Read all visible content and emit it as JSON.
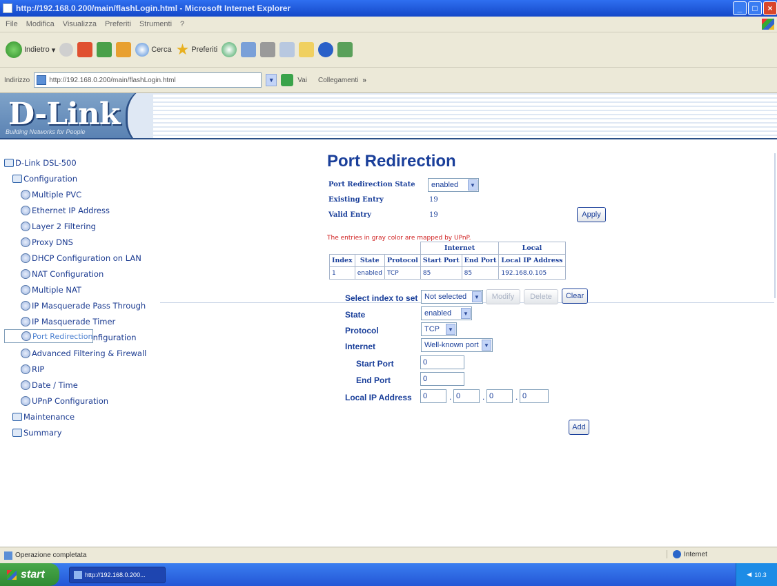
{
  "window": {
    "title": "http://192.168.0.200/main/flashLogin.html - Microsoft Internet Explorer"
  },
  "menu": [
    "File",
    "Modifica",
    "Visualizza",
    "Preferiti",
    "Strumenti",
    "?"
  ],
  "toolbar": {
    "back_label": "Indietro",
    "search_label": "Cerca",
    "favorites_label": "Preferiti"
  },
  "address": {
    "label": "Indirizzo",
    "url": "http://192.168.0.200/main/flashLogin.html",
    "go_label": "Vai",
    "links_label": "Collegamenti"
  },
  "banner": {
    "logo": "D-Link",
    "tagline": "Building Networks for People"
  },
  "tree": {
    "root": "D-Link DSL-500",
    "config": "Configuration",
    "items": [
      "Multiple PVC",
      "Ethernet IP Address",
      "Layer 2 Filtering",
      "Proxy DNS",
      "DHCP Configuration on LAN",
      "NAT Configuration",
      "Multiple NAT",
      "IP Masquerade Pass Through",
      "IP Masquerade Timer",
      "Port Redirection",
      "Static Route Configuration",
      "Advanced Filtering & Firewall",
      "RIP",
      "Date / Time",
      "UPnP Configuration"
    ],
    "maintenance": "Maintenance",
    "summary": "Summary"
  },
  "page": {
    "title": "Port Redirection",
    "state_label": "Port Redirection State",
    "state_value": "enabled",
    "existing_label": "Existing Entry",
    "existing_value": "19",
    "valid_label": "Valid Entry",
    "valid_value": "19",
    "apply_label": "Apply",
    "note": "The entries in gray color are mapped by UPnP.",
    "table": {
      "group_internet": "Internet",
      "group_local": "Local",
      "headers": [
        "Index",
        "State",
        "Protocol",
        "Start Port",
        "End Port",
        "Local IP Address"
      ],
      "rows": [
        [
          "1",
          "enabled",
          "TCP",
          "85",
          "85",
          "192.168.0.105"
        ]
      ]
    },
    "form": {
      "select_index_label": "Select index to set",
      "select_index_value": "Not selected",
      "modify_label": "Modify",
      "delete_label": "Delete",
      "clear_label": "Clear",
      "state_label": "State",
      "state_value": "enabled",
      "protocol_label": "Protocol",
      "protocol_value": "TCP",
      "internet_label": "Internet",
      "internet_value": "Well-known port",
      "start_port_label": "Start Port",
      "start_port_value": "0",
      "end_port_label": "End Port",
      "end_port_value": "0",
      "local_ip_label": "Local IP Address",
      "ip": [
        "0",
        "0",
        "0",
        "0"
      ],
      "add_label": "Add"
    }
  },
  "status": {
    "text": "Operazione completata",
    "zone": "Internet"
  },
  "taskbar": {
    "start": "start",
    "task": "http://192.168.0.200...",
    "clock": "10.3"
  },
  "colors": {
    "accent": "#1a3f9a",
    "note": "#d02020",
    "titlebar": "#2f6ff0"
  }
}
